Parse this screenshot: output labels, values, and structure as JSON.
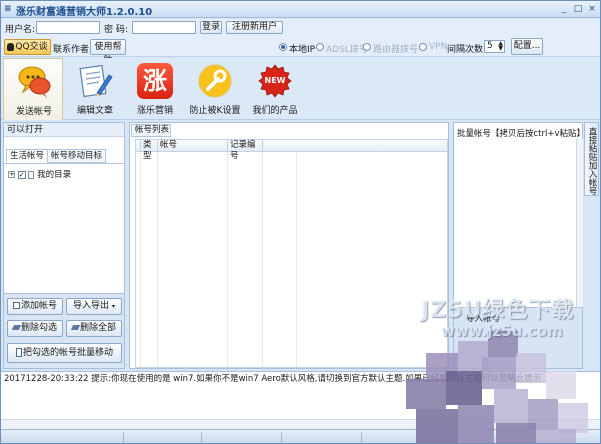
{
  "window": {
    "title": "涨乐财富通营销大师1.2.0.10",
    "title_icon": "≡",
    "controls": [
      "_",
      "□",
      "×"
    ]
  },
  "login": {
    "username_label": "用户名:",
    "password_label": "密  码:",
    "login_button": "登录",
    "register_button": "注册新用户"
  },
  "toolbar": {
    "qq_button": "QQ交谈",
    "contact_label": "联系作者",
    "help_button": "使用帮助",
    "ip_options": [
      {
        "label": "本地IP",
        "selected": true,
        "enabled": true
      },
      {
        "label": "ADSL拨号",
        "selected": false,
        "enabled": false
      },
      {
        "label": "路由器拨号",
        "selected": false,
        "enabled": false
      },
      {
        "label": "VPN",
        "selected": false,
        "enabled": false
      }
    ],
    "interval_label": "间隔次数",
    "interval_value": "5",
    "config_button": "配置..."
  },
  "tools": [
    {
      "label": "发送帐号",
      "icon": "chat-bubbles-icon",
      "active": true
    },
    {
      "label": "编辑文章",
      "icon": "edit-document-icon",
      "active": false
    },
    {
      "label": "涨乐营销",
      "icon": "zhang-logo-icon",
      "glyph": "涨",
      "active": false
    },
    {
      "label": "防止被K设置",
      "icon": "wrench-icon",
      "active": false
    },
    {
      "label": "我们的产品",
      "icon": "new-badge-icon",
      "glyph": "NEW",
      "active": false
    }
  ],
  "left_panel": {
    "header": "可以打开",
    "tabs": [
      "生活帐号",
      "帐号移动目标"
    ],
    "tree_item": "我的目录",
    "buttons": {
      "add_account": "添加帐号",
      "import_export": "导入导出",
      "delete_checked": "删除勾选",
      "delete_all": "删除全部",
      "batch_move": "把勾选的帐号批量移动"
    }
  },
  "middle_panel": {
    "tab": "帐号列表",
    "columns": [
      "类型",
      "帐号",
      "记录编号"
    ]
  },
  "right_panel": {
    "header": "批量帐号【拷贝后按ctrl+v粘贴】",
    "button_partial": "导入帐号",
    "vertical_tab": "直接粘贴加入帐号"
  },
  "log": {
    "line": "20171228-20:33:22  提示:你现在使用的是 win7.如果你不是win7 Aero默认风格,请切换到官方默认主题.如果已经是默认主题可以忽略此提示"
  },
  "watermark": {
    "text": "JZ5U绿色下载",
    "url": "www.jz5u.com"
  },
  "colors": {
    "title_text": "#1f4f8f",
    "panel_border": "#a9bfd9",
    "window_bg": "#d6e6f7"
  }
}
